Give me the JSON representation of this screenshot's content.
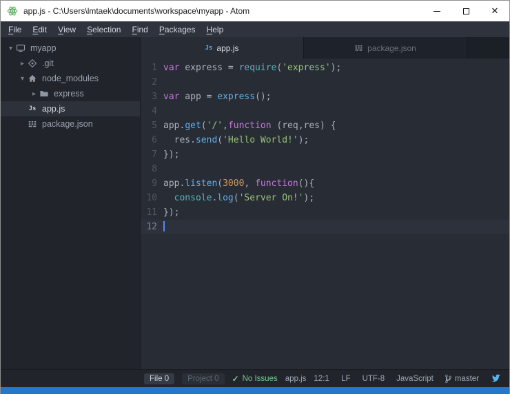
{
  "window": {
    "title": "app.js - C:\\Users\\lmtaek\\documents\\workspace\\myapp - Atom",
    "controls": {
      "minimize": "minimize",
      "maximize": "maximize",
      "close": "✕"
    }
  },
  "menu": {
    "items": [
      "File",
      "Edit",
      "View",
      "Selection",
      "Find",
      "Packages",
      "Help"
    ]
  },
  "tree": {
    "items": [
      {
        "label": "myapp",
        "level": 0,
        "chevron": "down",
        "icon": "device",
        "selected": false
      },
      {
        "label": ".git",
        "level": 1,
        "chevron": "right",
        "icon": "git",
        "selected": false
      },
      {
        "label": "node_modules",
        "level": 1,
        "chevron": "down",
        "icon": "home",
        "selected": false
      },
      {
        "label": "express",
        "level": 2,
        "chevron": "right",
        "icon": "folder",
        "selected": false
      },
      {
        "label": "app.js",
        "level": 1,
        "chevron": "none",
        "icon": "js",
        "selected": true
      },
      {
        "label": "package.json",
        "level": 1,
        "chevron": "none",
        "icon": "npm",
        "selected": false
      }
    ]
  },
  "tabs": [
    {
      "label": "app.js",
      "icon": "js",
      "active": true
    },
    {
      "label": "package.json",
      "icon": "npm",
      "active": false
    }
  ],
  "editor": {
    "lines": [
      {
        "n": "1",
        "tokens": [
          [
            "k",
            "var"
          ],
          [
            "p",
            " express = "
          ],
          [
            "c",
            "require"
          ],
          [
            "p",
            "("
          ],
          [
            "s",
            "'express'"
          ],
          [
            "p",
            ");"
          ]
        ]
      },
      {
        "n": "2",
        "tokens": []
      },
      {
        "n": "3",
        "tokens": [
          [
            "k",
            "var"
          ],
          [
            "p",
            " app = "
          ],
          [
            "f",
            "express"
          ],
          [
            "p",
            "();"
          ]
        ]
      },
      {
        "n": "4",
        "tokens": []
      },
      {
        "n": "5",
        "tokens": [
          [
            "p",
            "app."
          ],
          [
            "f",
            "get"
          ],
          [
            "p",
            "("
          ],
          [
            "s",
            "'/'"
          ],
          [
            "p",
            ","
          ],
          [
            "k",
            "function"
          ],
          [
            "p",
            " (req,res) {"
          ]
        ]
      },
      {
        "n": "6",
        "tokens": [
          [
            "p",
            "  res."
          ],
          [
            "f",
            "send"
          ],
          [
            "p",
            "("
          ],
          [
            "s",
            "'Hello World!'"
          ],
          [
            "p",
            ");"
          ]
        ]
      },
      {
        "n": "7",
        "tokens": [
          [
            "p",
            "});"
          ]
        ]
      },
      {
        "n": "8",
        "tokens": []
      },
      {
        "n": "9",
        "tokens": [
          [
            "p",
            "app."
          ],
          [
            "f",
            "listen"
          ],
          [
            "p",
            "("
          ],
          [
            "n",
            "3000"
          ],
          [
            "p",
            ", "
          ],
          [
            "k",
            "function"
          ],
          [
            "p",
            "(){"
          ]
        ]
      },
      {
        "n": "10",
        "tokens": [
          [
            "p",
            "  "
          ],
          [
            "c",
            "console"
          ],
          [
            "p",
            "."
          ],
          [
            "f",
            "log"
          ],
          [
            "p",
            "("
          ],
          [
            "s",
            "'Server On!'"
          ],
          [
            "p",
            ");"
          ]
        ]
      },
      {
        "n": "11",
        "tokens": [
          [
            "p",
            "});"
          ]
        ]
      },
      {
        "n": "12",
        "tokens": [],
        "active": true,
        "cursor": true
      }
    ]
  },
  "status": {
    "file_counter": "File 0",
    "project_counter": "Project 0",
    "issues": "No Issues",
    "file_name": "app.js",
    "cursor_position": "12:1",
    "line_ending": "LF",
    "encoding": "UTF-8",
    "grammar": "JavaScript",
    "branch": "master"
  },
  "colors": {
    "keyword": "#c678dd",
    "function": "#61afef",
    "string": "#98c379",
    "number": "#d19a66",
    "support": "#56b6c2",
    "success": "#73c990",
    "cursor": "#528bff",
    "taskbar": "#2478cc",
    "logo_green": "#57a85a",
    "bird_blue": "#59b3f0"
  }
}
